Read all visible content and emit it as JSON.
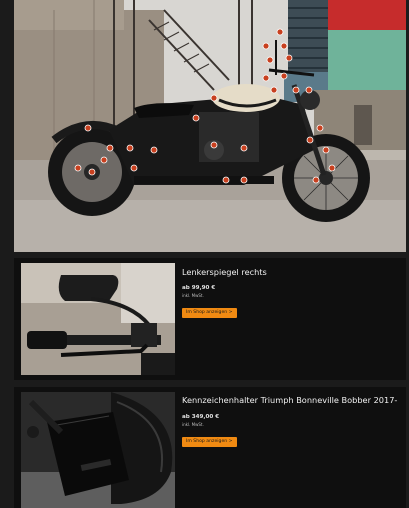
{
  "hero": {
    "image_icon": "motorcycle-photo"
  },
  "products": [
    {
      "title": "Lenkerspiegel rechts",
      "price": "ab 99,90 €",
      "tax_note": "inkl. MwSt.",
      "shop_button": "Im Shop anzeigen >",
      "image_icon": "mirror-photo"
    },
    {
      "title": "Kennzeichenhalter Triumph Bonneville Bobber 2017-",
      "price": "ab 349,00 €",
      "tax_note": "inkl. MwSt.",
      "shop_button": "Im Shop anzeigen >",
      "image_icon": "license-plate-holder-photo"
    }
  ],
  "colors": {
    "button": "#f08a12",
    "background": "#1b1b1b",
    "card": "#0f0f0f"
  }
}
